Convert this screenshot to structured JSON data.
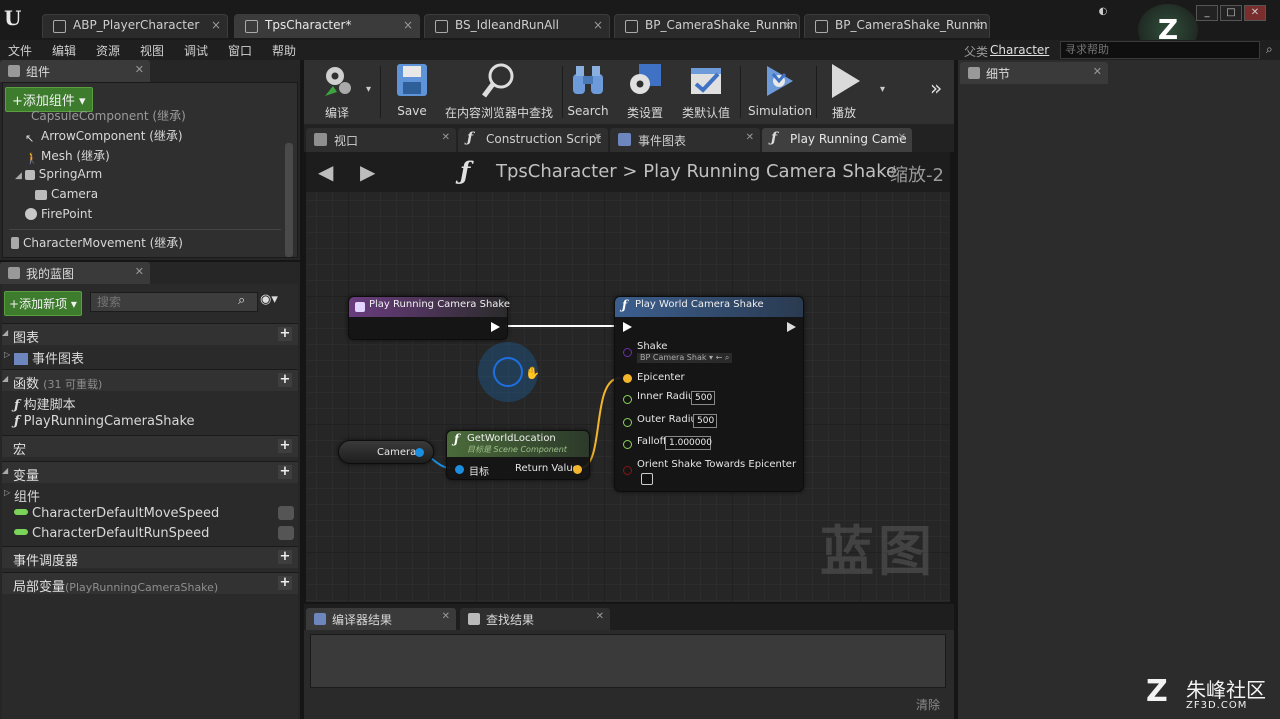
{
  "window": {
    "doc_tabs": [
      {
        "label": "ABP_PlayerCharacter",
        "active": false
      },
      {
        "label": "TpsCharacter*",
        "active": true
      },
      {
        "label": "BS_IdleandRunAll",
        "active": false
      },
      {
        "label": "BP_CameraShake_Runnin",
        "active": false
      },
      {
        "label": "BP_CameraShake_Runnin",
        "active": false
      }
    ]
  },
  "menu": {
    "items": [
      "文件",
      "编辑",
      "资源",
      "视图",
      "调试",
      "窗口",
      "帮助"
    ],
    "parent_label": "父类",
    "parent_class": "Character",
    "help_search_placeholder": "寻求帮助"
  },
  "components_panel": {
    "title": "组件",
    "add_button": "添加组件",
    "items": [
      {
        "label": "CapsuleComponent (继承)",
        "icon": "capsule-icon"
      },
      {
        "label": "ArrowComponent (继承)",
        "icon": "arrow-icon"
      },
      {
        "label": "Mesh (继承)",
        "icon": "mesh-icon"
      },
      {
        "label": "SpringArm",
        "icon": "springarm-icon"
      },
      {
        "label": "Camera",
        "icon": "camera-icon"
      },
      {
        "label": "FirePoint",
        "icon": "sphere-icon"
      },
      {
        "label": "CharacterMovement (继承)",
        "icon": "movement-icon"
      }
    ]
  },
  "my_blueprint": {
    "title": "我的蓝图",
    "add_button": "添加新项",
    "search_placeholder": "搜索",
    "sections": {
      "graphs": "图表",
      "event_graph": "事件图表",
      "functions": "函数",
      "functions_count": "(31 可重载)",
      "func_construction": "构建脚本",
      "func_play": "PlayRunningCameraShake",
      "macros": "宏",
      "variables": "变量",
      "components": "组件",
      "var1": "CharacterDefaultMoveSpeed",
      "var2": "CharacterDefaultRunSpeed",
      "dispatchers": "事件调度器",
      "local_vars": "局部变量",
      "local_vars_scope": "(PlayRunningCameraShake)"
    }
  },
  "toolbar": {
    "compile": "编译",
    "save": "Save",
    "find_in_cb": "在内容浏览器中查找",
    "search": "Search",
    "class_settings": "类设置",
    "class_defaults": "类默认值",
    "simulation": "Simulation",
    "play": "播放"
  },
  "editor_tabs": [
    {
      "label": "视口",
      "icon": "viewport-icon"
    },
    {
      "label": "Construction Script",
      "icon": "function-icon"
    },
    {
      "label": "事件图表",
      "icon": "graph-icon"
    },
    {
      "label": "Play Running Came",
      "icon": "function-icon"
    }
  ],
  "graph": {
    "breadcrumb_class": "TpsCharacter",
    "breadcrumb_sep": ">",
    "breadcrumb_func": "Play Running Camera Shake",
    "zoom": "缩放-2",
    "watermark": "蓝图",
    "nodes": {
      "entry": {
        "title": "Play Running Camera Shake"
      },
      "play_world": {
        "title": "Play World Camera Shake",
        "shake_label": "Shake",
        "shake_value": "BP Camera Shak",
        "epicenter": "Epicenter",
        "inner_radius": "Inner Radius",
        "inner_radius_value": "500",
        "outer_radius": "Outer Radius",
        "outer_radius_value": "500",
        "falloff": "Falloff",
        "falloff_value": "1.000000",
        "orient": "Orient Shake Towards Epicenter"
      },
      "get_world_location": {
        "title": "GetWorldLocation",
        "subtitle": "目标是 Scene Component",
        "target": "目标",
        "return_value": "Return Value"
      },
      "camera": {
        "label": "Camera"
      }
    }
  },
  "results": {
    "tabs": [
      "编译器结果",
      "查找结果"
    ],
    "clear": "清除"
  },
  "details": {
    "title": "细节"
  },
  "brand": {
    "name": "朱峰社区",
    "url": "ZF3D.COM"
  },
  "colors": {
    "function_header": "#3c5f8f",
    "entry_header": "#6a3c7f",
    "pure_header": "#4b6b3a",
    "vector_pin": "#f2b52b",
    "object_pin": "#1b8ee0",
    "float_pin": "#8cd45a",
    "bool_pin": "#8b1414",
    "add_button": "#3d7b2d"
  }
}
